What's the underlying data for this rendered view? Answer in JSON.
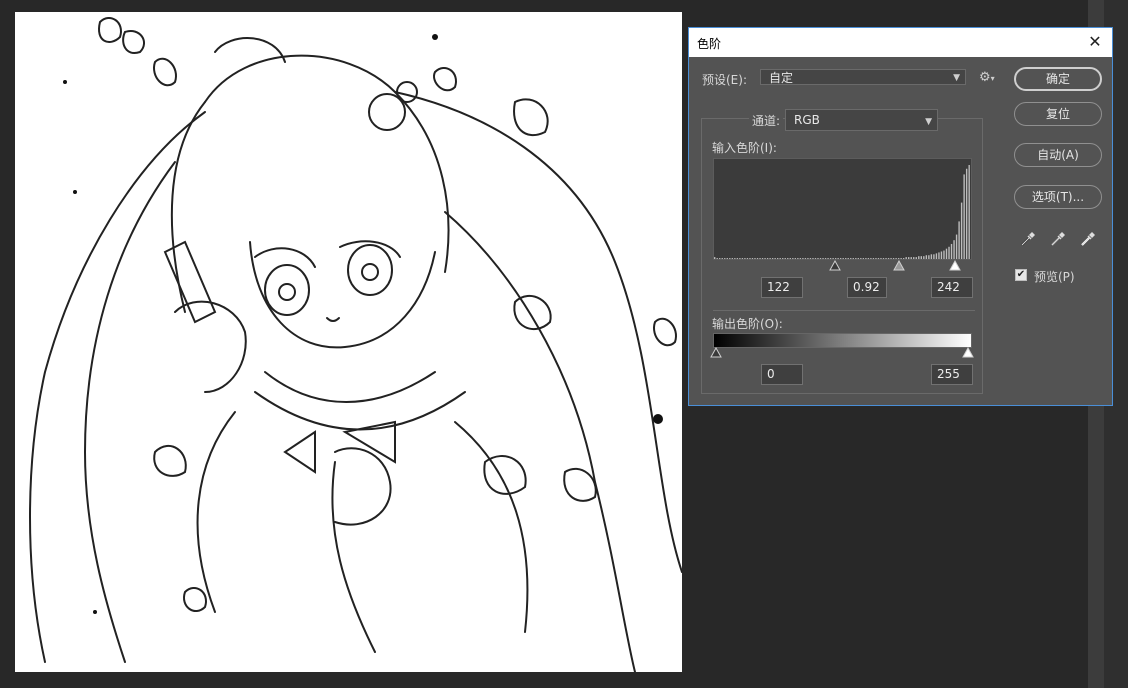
{
  "dialog": {
    "title": "色阶",
    "close_symbol": "✕",
    "preset_label": "预设(E):",
    "preset_value": "自定",
    "channel_label": "通道:",
    "channel_value": "RGB",
    "input_levels_label": "输入色阶(I):",
    "input_black": "122",
    "input_gamma": "0.92",
    "input_white": "242",
    "output_levels_label": "输出色阶(O):",
    "output_black": "0",
    "output_white": "255"
  },
  "buttons": {
    "ok": "确定",
    "reset": "复位",
    "auto": "自动(A)",
    "options": "选项(T)..."
  },
  "preview": {
    "label": "预览(P)",
    "checked": true
  },
  "icons": {
    "gear": "gear-icon",
    "eyedroppers": [
      "black-point-eyedropper-icon",
      "gray-point-eyedropper-icon",
      "white-point-eyedropper-icon"
    ]
  },
  "chart_data": {
    "type": "bar",
    "histogram_levels_range": [
      0,
      255
    ],
    "histogram_bins": [
      2,
      1,
      1,
      1,
      1,
      1,
      1,
      1,
      1,
      1,
      1,
      1,
      1,
      1,
      1,
      1,
      1,
      1,
      1,
      1,
      1,
      1,
      1,
      1,
      1,
      1,
      1,
      1,
      1,
      1,
      1,
      1,
      1,
      1,
      1,
      1,
      1,
      1,
      1,
      1,
      1,
      1,
      1,
      1,
      1,
      1,
      1,
      1,
      1,
      1,
      1,
      1,
      1,
      1,
      1,
      1,
      1,
      1,
      1,
      1,
      1,
      1,
      1,
      1,
      1,
      1,
      1,
      1,
      1,
      1,
      1,
      1,
      1,
      1,
      1,
      1,
      2,
      2,
      2,
      2,
      2,
      3,
      3,
      3,
      4,
      4,
      5,
      5,
      6,
      7,
      8,
      9,
      11,
      13,
      16,
      20,
      26,
      40,
      60,
      90,
      96,
      100
    ]
  },
  "colors": {
    "dialog_bg": "#535353",
    "dialog_border": "#4a8fd8",
    "histogram_bar": "#bdbdbd"
  }
}
